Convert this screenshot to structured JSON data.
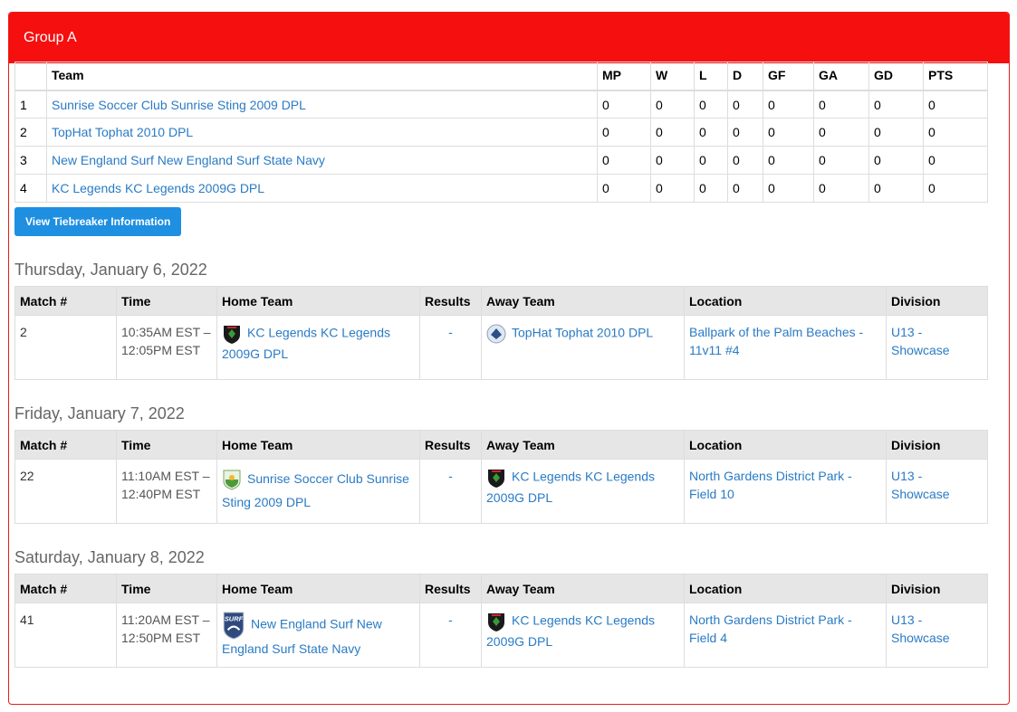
{
  "group_title": "Group A",
  "standings": {
    "headers": [
      "",
      "Team",
      "MP",
      "W",
      "L",
      "D",
      "GF",
      "GA",
      "GD",
      "PTS"
    ],
    "rows": [
      {
        "rank": "1",
        "team": "Sunrise Soccer Club Sunrise Sting 2009 DPL",
        "mp": "0",
        "w": "0",
        "l": "0",
        "d": "0",
        "gf": "0",
        "ga": "0",
        "gd": "0",
        "pts": "0"
      },
      {
        "rank": "2",
        "team": "TopHat Tophat 2010 DPL",
        "mp": "0",
        "w": "0",
        "l": "0",
        "d": "0",
        "gf": "0",
        "ga": "0",
        "gd": "0",
        "pts": "0"
      },
      {
        "rank": "3",
        "team": "New England Surf New England Surf State Navy",
        "mp": "0",
        "w": "0",
        "l": "0",
        "d": "0",
        "gf": "0",
        "ga": "0",
        "gd": "0",
        "pts": "0"
      },
      {
        "rank": "4",
        "team": "KC Legends KC Legends 2009G DPL",
        "mp": "0",
        "w": "0",
        "l": "0",
        "d": "0",
        "gf": "0",
        "ga": "0",
        "gd": "0",
        "pts": "0"
      }
    ]
  },
  "tiebreaker_button": "View Tiebreaker Information",
  "schedule_headers": [
    "Match #",
    "Time",
    "Home Team",
    "Results",
    "Away Team",
    "Location",
    "Division"
  ],
  "days": [
    {
      "date": "Thursday, January 6, 2022",
      "match": {
        "number": "2",
        "time_start": "10:35AM EST –",
        "time_end": "12:05PM EST",
        "home_team": "KC Legends KC Legends 2009G DPL",
        "home_logo": "kc-legends-logo",
        "result": "-",
        "away_team": "TopHat Tophat 2010 DPL",
        "away_logo": "tophat-logo",
        "location": "Ballpark of the Palm Beaches - 11v11 #4",
        "division": "U13 - Showcase"
      }
    },
    {
      "date": "Friday, January 7, 2022",
      "match": {
        "number": "22",
        "time_start": "11:10AM EST –",
        "time_end": "12:40PM EST",
        "home_team": "Sunrise Soccer Club Sunrise Sting 2009 DPL",
        "home_logo": "sunrise-logo",
        "result": "-",
        "away_team": "KC Legends KC Legends 2009G DPL",
        "away_logo": "kc-legends-logo",
        "location": "North Gardens District Park - Field 10",
        "division": "U13 - Showcase"
      }
    },
    {
      "date": "Saturday, January 8, 2022",
      "match": {
        "number": "41",
        "time_start": "11:20AM EST –",
        "time_end": "12:50PM EST",
        "home_team": "New England Surf New England Surf State Navy",
        "home_logo": "ne-surf-logo",
        "result": "-",
        "away_team": "KC Legends KC Legends 2009G DPL",
        "away_logo": "kc-legends-logo",
        "location": "North Gardens District Park - Field 4",
        "division": "U13 - Showcase"
      }
    }
  ],
  "colors": {
    "header_red": "#f50f0f",
    "link_blue": "#2a7bc4",
    "button_blue": "#1e8fe1"
  }
}
